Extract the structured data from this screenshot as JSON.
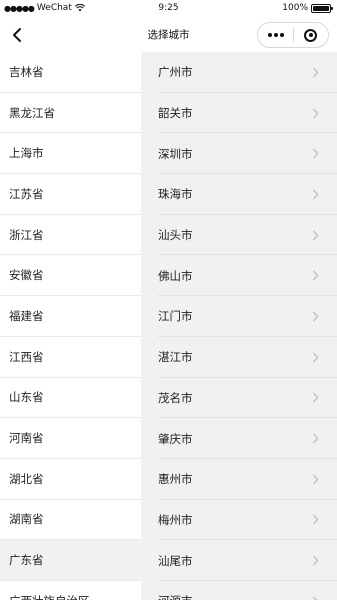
{
  "status_bar": {
    "signal": "●●●●●",
    "carrier": "WeChat",
    "time": "9:25",
    "battery_text": "100%"
  },
  "nav": {
    "title": "选择城市",
    "back_icon": "chevron-left-icon",
    "more_icon": "more-dots-icon",
    "close_icon": "target-icon"
  },
  "provinces": [
    {
      "label": "吉林省",
      "selected": false
    },
    {
      "label": "黑龙江省",
      "selected": false
    },
    {
      "label": "上海市",
      "selected": false
    },
    {
      "label": "江苏省",
      "selected": false
    },
    {
      "label": "浙江省",
      "selected": false
    },
    {
      "label": "安徽省",
      "selected": false
    },
    {
      "label": "福建省",
      "selected": false
    },
    {
      "label": "江西省",
      "selected": false
    },
    {
      "label": "山东省",
      "selected": false
    },
    {
      "label": "河南省",
      "selected": false
    },
    {
      "label": "湖北省",
      "selected": false
    },
    {
      "label": "湖南省",
      "selected": false
    },
    {
      "label": "广东省",
      "selected": true
    },
    {
      "label": "广西壮族自治区",
      "selected": false
    }
  ],
  "cities": [
    {
      "label": "广州市"
    },
    {
      "label": "韶关市"
    },
    {
      "label": "深圳市"
    },
    {
      "label": "珠海市"
    },
    {
      "label": "汕头市"
    },
    {
      "label": "佛山市"
    },
    {
      "label": "江门市"
    },
    {
      "label": "湛江市"
    },
    {
      "label": "茂名市"
    },
    {
      "label": "肇庆市"
    },
    {
      "label": "惠州市"
    },
    {
      "label": "梅州市"
    },
    {
      "label": "汕尾市"
    },
    {
      "label": "河源市"
    }
  ],
  "colors": {
    "selected_background": "#f1f1f1",
    "chevron": "#b8b8b8"
  }
}
